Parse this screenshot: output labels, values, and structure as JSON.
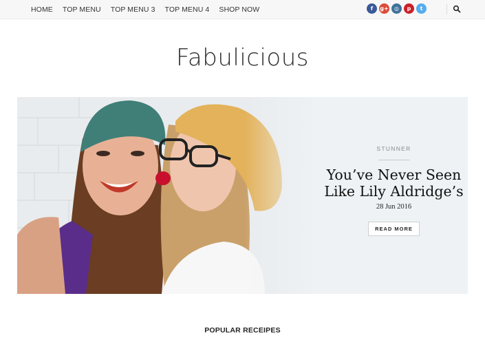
{
  "nav": {
    "items": [
      {
        "label": "HOME"
      },
      {
        "label": "TOP MENU"
      },
      {
        "label": "TOP MENU 3"
      },
      {
        "label": "TOP MENU 4"
      },
      {
        "label": "SHOP NOW"
      }
    ]
  },
  "social": [
    {
      "icon": "facebook-icon",
      "glyph": "f",
      "color": "#3b5998"
    },
    {
      "icon": "google-plus-icon",
      "glyph": "g+",
      "color": "#dd4b39"
    },
    {
      "icon": "instagram-icon",
      "glyph": "◎",
      "color": "#3f729b"
    },
    {
      "icon": "pinterest-icon",
      "glyph": "p",
      "color": "#cb2027"
    },
    {
      "icon": "twitter-icon",
      "glyph": "t",
      "color": "#55acee"
    }
  ],
  "logo": {
    "text": "Fabulicious"
  },
  "hero": {
    "category": "STUNNER",
    "title_line1": "You’ve Never Seen",
    "title_line2": "Like Lily Aldridge’s",
    "date": "28 Jun 2016",
    "button": "READ MORE"
  },
  "section": {
    "title": "POPULAR RECEIPES"
  }
}
